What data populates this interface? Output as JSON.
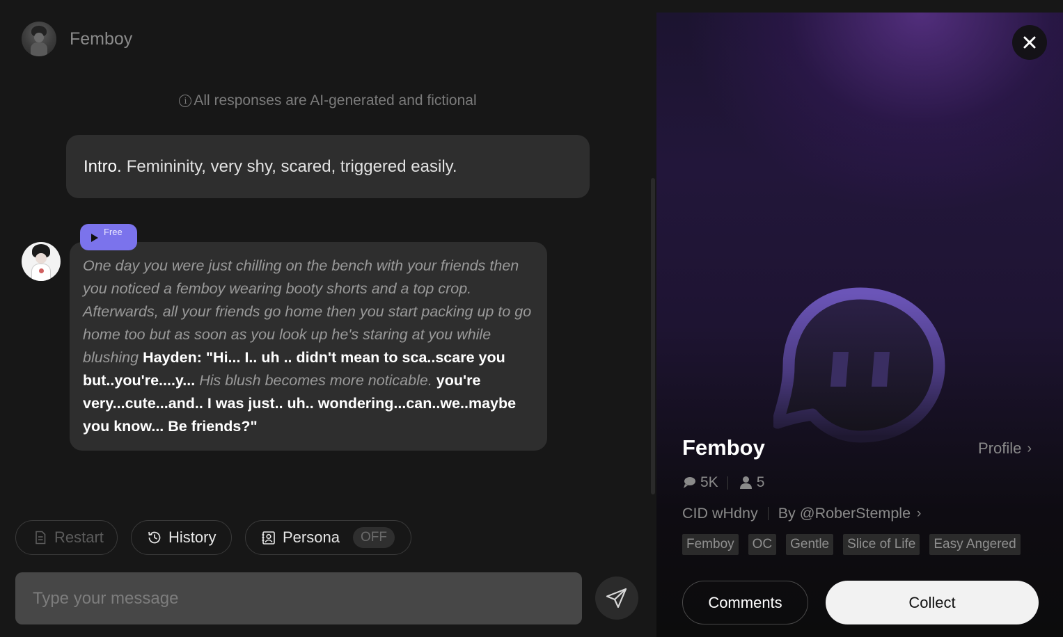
{
  "chat": {
    "header": {
      "name": "Femboy"
    },
    "disclaimer": "All responses are AI-generated and fictional",
    "intro": {
      "label": "Intro.",
      "text": "Femininity, very shy, scared, triggered easily."
    },
    "message": {
      "badge": "Free",
      "segments": [
        {
          "type": "action",
          "text": "One day you were just chilling on the bench with your friends then you noticed a femboy wearing booty shorts and a top crop. Afterwards, all your friends go home then you start packing up to go home too but as soon as you look up he's staring at you while blushing"
        },
        {
          "type": "speech",
          "text": " Hayden: \"Hi... I.. uh .. didn't mean to sca..scare you but..you're....y... "
        },
        {
          "type": "action",
          "text": "His blush becomes more noticable."
        },
        {
          "type": "speech",
          "text": " you're very...cute...and.. I was just.. uh.. wondering...can..we..maybe you know... Be friends?\""
        }
      ]
    },
    "actions": {
      "restart": "Restart",
      "history": "History",
      "persona": "Persona",
      "persona_state": "OFF"
    },
    "input": {
      "placeholder": "Type your message",
      "value": ""
    }
  },
  "panel": {
    "name": "Femboy",
    "profile_link": "Profile",
    "stats": {
      "chats": "5K",
      "users": "5"
    },
    "cid": "CID wHdny",
    "author": "By @RoberStemple",
    "tags": [
      "Femboy",
      "OC",
      "Gentle",
      "Slice of Life",
      "Easy Angered"
    ],
    "comments_label": "Comments",
    "collect_label": "Collect"
  },
  "colors": {
    "accent": "#7b73ec",
    "background": "#171717",
    "bubble": "#2e2e2e",
    "input": "#474747"
  },
  "icons": [
    "info-icon",
    "play-icon",
    "restart-icon",
    "history-icon",
    "persona-icon",
    "send-icon",
    "close-icon",
    "chat-bubble-icon",
    "user-icon",
    "chevron-right-icon",
    "ghost-logo-icon"
  ]
}
